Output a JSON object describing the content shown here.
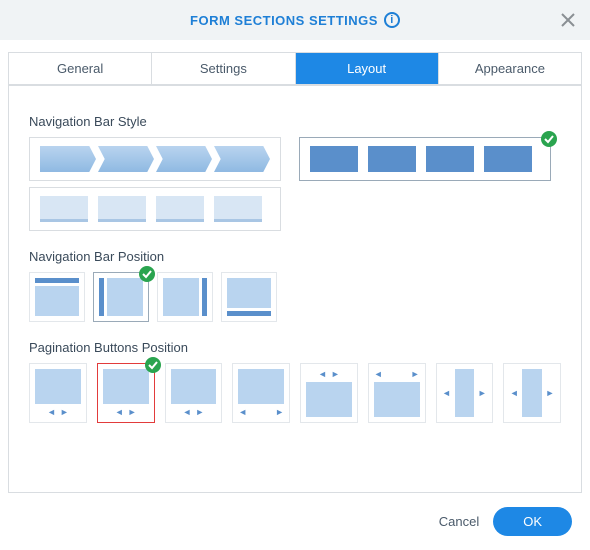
{
  "header": {
    "title": "FORM SECTIONS SETTINGS"
  },
  "tabs": [
    {
      "label": "General",
      "active": false
    },
    {
      "label": "Settings",
      "active": false
    },
    {
      "label": "Layout",
      "active": true
    },
    {
      "label": "Appearance",
      "active": false
    }
  ],
  "layout": {
    "navStyle": {
      "label": "Navigation Bar Style",
      "options": [
        "arrows",
        "solid-tabs",
        "underline-tabs"
      ],
      "selected": "solid-tabs"
    },
    "navPosition": {
      "label": "Navigation Bar Position",
      "options": [
        "top",
        "left",
        "right",
        "bottom"
      ],
      "selected": "left"
    },
    "paginationPosition": {
      "label": "Pagination Buttons Position",
      "options": [
        "bottom-center",
        "bottom-center-highlight",
        "bottom-center-alt",
        "bottom-spread",
        "top-center",
        "top-spread",
        "sides-middle",
        "sides-middle-alt"
      ],
      "selected": "bottom-center-highlight",
      "highlighted": "bottom-center-highlight"
    }
  },
  "footer": {
    "cancel_label": "Cancel",
    "ok_label": "OK"
  },
  "colors": {
    "accent": "#1e88e5",
    "success": "#2aa44f",
    "highlight": "#e23b3b"
  }
}
